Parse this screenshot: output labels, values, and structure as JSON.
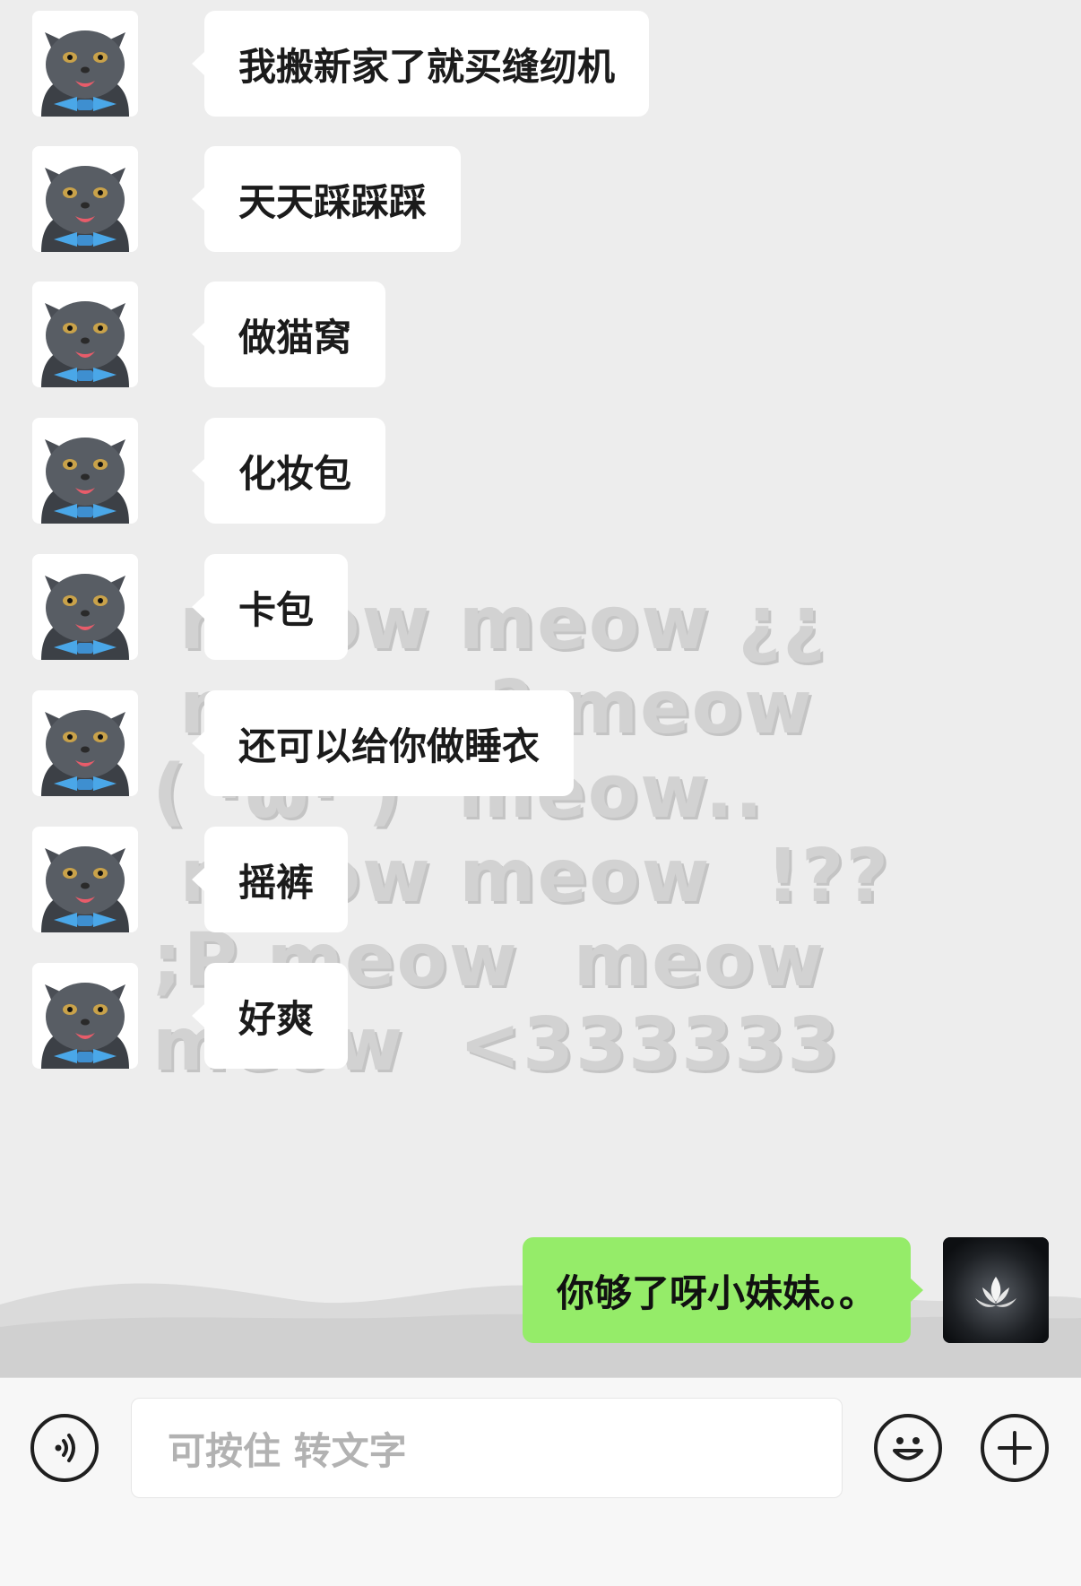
{
  "watermark": {
    "lines": [
      "meow meow ¿¿",
      "meow ;? meow",
      "( ·ω· )  meow..",
      " meow meow  !??",
      ";P meow  meow",
      "meow  <333333"
    ]
  },
  "messages": [
    {
      "sender": "cat",
      "text": "我搬新家了就买缝纫机"
    },
    {
      "sender": "cat",
      "text": "天天踩踩踩"
    },
    {
      "sender": "cat",
      "text": "做猫窝"
    },
    {
      "sender": "cat",
      "text": "化妆包"
    },
    {
      "sender": "cat",
      "text": "卡包"
    },
    {
      "sender": "cat",
      "text": "还可以给你做睡衣"
    },
    {
      "sender": "cat",
      "text": "摇裤"
    },
    {
      "sender": "cat",
      "text": "好爽"
    }
  ],
  "reply": {
    "sender": "self",
    "text": "你够了呀小妹妹。。"
  },
  "input": {
    "placeholder": "可按住 转文字"
  },
  "icons": {
    "voice": "voice-icon",
    "emoji": "emoji-icon",
    "plus": "plus-icon"
  },
  "colors": {
    "self_bubble": "#95ec69",
    "other_bubble": "#ffffff",
    "background": "#ededed"
  }
}
